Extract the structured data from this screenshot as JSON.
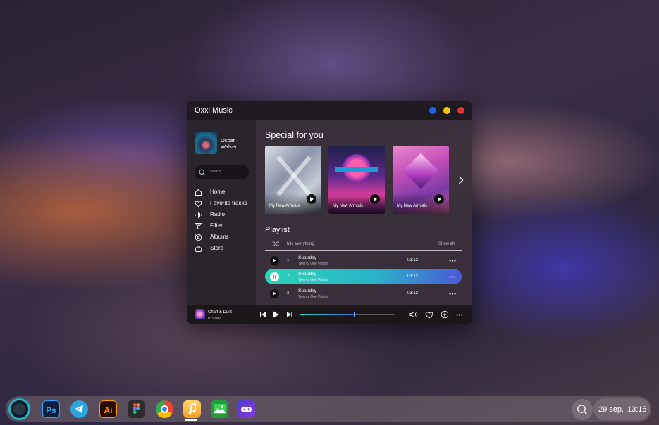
{
  "window": {
    "title": "Oxxi Music",
    "controls": {
      "blue": "#1d63e6",
      "yellow": "#f2c511",
      "red": "#e4353b"
    }
  },
  "sidebar": {
    "user_name": "Oscar Walker",
    "search_placeholder": "Search",
    "nav": [
      {
        "label": "Home",
        "icon": "home-icon"
      },
      {
        "label": "Favorite tracks",
        "icon": "heart-icon"
      },
      {
        "label": "Radio",
        "icon": "radio-icon"
      },
      {
        "label": "Filter",
        "icon": "filter-icon",
        "expandable": true
      },
      {
        "label": "Albums",
        "icon": "disc-icon",
        "expandable": true
      },
      {
        "label": "Store",
        "icon": "bag-icon"
      }
    ]
  },
  "special": {
    "title": "Special for you",
    "cards": [
      {
        "label": "My New Arrivals"
      },
      {
        "label": "My New Arrivals"
      },
      {
        "label": "My New Arrivals"
      }
    ]
  },
  "playlist": {
    "title": "Playlist",
    "mix_label": "Mix everything",
    "show_all": "Show all",
    "tracks": [
      {
        "num": "1",
        "title": "Suturday",
        "artist": "Twenty One Pistols",
        "time": "03:12",
        "playing": false
      },
      {
        "num": "2",
        "title": "Suturday",
        "artist": "Twenty One Pistols",
        "time": "03:12",
        "playing": true
      },
      {
        "num": "3",
        "title": "Suturday",
        "artist": "Twenty One Pistols",
        "time": "03:12",
        "playing": false
      }
    ]
  },
  "player": {
    "title": "Chaff & Dust",
    "artist": "HYONNA",
    "progress": 0.58
  },
  "taskbar": {
    "apps": [
      "cortana",
      "photoshop",
      "telegram",
      "illustrator",
      "figma",
      "chrome",
      "music",
      "gallery",
      "games"
    ],
    "ps_label": "Ps",
    "ai_label": "Ai",
    "date": "29 sep,",
    "time": "13:15"
  }
}
